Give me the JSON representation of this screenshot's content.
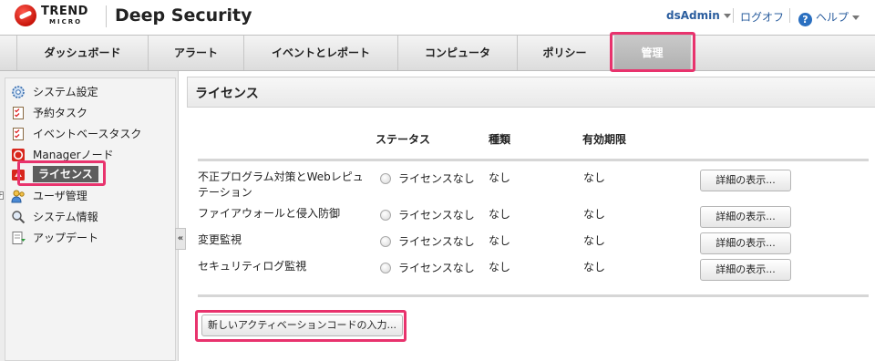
{
  "header": {
    "brand_line1": "TREND",
    "brand_line2": "MICRO",
    "app_title": "Deep Security",
    "user": "dsAdmin",
    "logout": "ログオフ",
    "help": "ヘルプ"
  },
  "tabs": [
    {
      "label": "ダッシュボード"
    },
    {
      "label": "アラート"
    },
    {
      "label": "イベントとレポート"
    },
    {
      "label": "コンピュータ"
    },
    {
      "label": "ポリシー"
    },
    {
      "label": "管理",
      "active": true
    }
  ],
  "sidebar": {
    "items": [
      {
        "label": "システム設定",
        "icon": "gear-icon"
      },
      {
        "label": "予約タスク",
        "icon": "task-icon"
      },
      {
        "label": "イベントベースタスク",
        "icon": "task-icon"
      },
      {
        "label": "Managerノード",
        "icon": "manager-node-icon"
      },
      {
        "label": "ライセンス",
        "icon": "license-icon",
        "selected": true
      },
      {
        "label": "ユーザ管理",
        "icon": "users-icon",
        "expandable": true
      },
      {
        "label": "システム情報",
        "icon": "magnifier-icon"
      },
      {
        "label": "アップデート",
        "icon": "update-icon"
      }
    ],
    "collapse_glyph": "«"
  },
  "main": {
    "title": "ライセンス",
    "columns": {
      "status": "ステータス",
      "type": "種類",
      "expiry": "有効期限"
    },
    "rows": [
      {
        "feature": "不正プログラム対策とWebレピュテーション",
        "status": "ライセンスなし",
        "type": "なし",
        "expiry": "なし",
        "button": "詳細の表示..."
      },
      {
        "feature": "ファイアウォールと侵入防御",
        "status": "ライセンスなし",
        "type": "なし",
        "expiry": "なし",
        "button": "詳細の表示..."
      },
      {
        "feature": "変更監視",
        "status": "ライセンスなし",
        "type": "なし",
        "expiry": "なし",
        "button": "詳細の表示..."
      },
      {
        "feature": "セキュリティログ監視",
        "status": "ライセンスなし",
        "type": "なし",
        "expiry": "なし",
        "button": "詳細の表示..."
      }
    ],
    "new_code_button": "新しいアクティベーションコードの入力..."
  },
  "colors": {
    "highlight": "#e8336d",
    "link": "#2a5d9e",
    "selected_item": "#5d5d5d"
  }
}
